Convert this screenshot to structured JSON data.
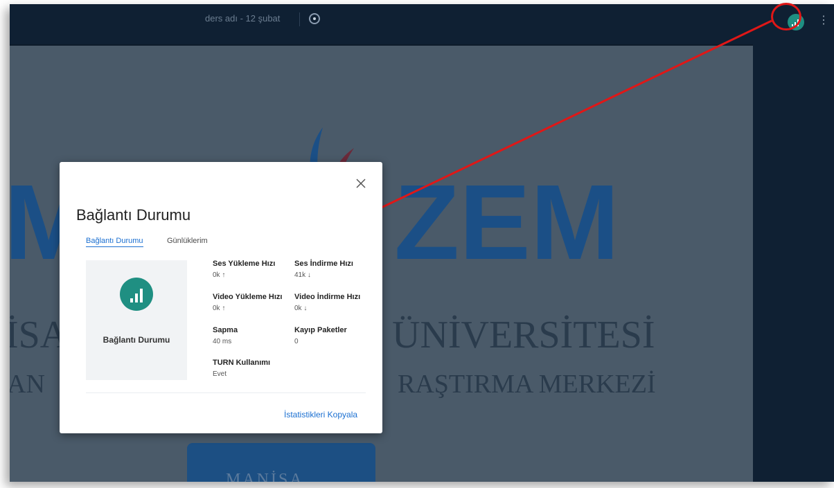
{
  "topbar": {
    "meeting_title": "ders adı - 12 şubat",
    "record_icon": "record-icon",
    "signal_icon": "signal-bars-icon",
    "more_icon": "more-vertical-icon"
  },
  "slide": {
    "watermark_left": "M",
    "watermark_right": "ZEM",
    "university_left": "İSA",
    "university_right": "ÜNİVERSİTESİ",
    "center_left": "AN",
    "center_right": "RAŞTIRMA MERKEZİ",
    "logo_text": "MANİSA"
  },
  "modal": {
    "title": "Bağlantı Durumu",
    "close_icon": "close-icon",
    "tabs": [
      {
        "label": "Bağlantı Durumu",
        "active": true
      },
      {
        "label": "Günlüklerim",
        "active": false
      }
    ],
    "status_label": "Bağlantı Durumu",
    "stats": [
      {
        "label": "Ses Yükleme Hızı",
        "value": "0k ↑"
      },
      {
        "label": "Ses İndirme Hızı",
        "value": "41k ↓"
      },
      {
        "label": "Video Yükleme Hızı",
        "value": "0k ↑"
      },
      {
        "label": "Video İndirme Hızı",
        "value": "0k ↓"
      },
      {
        "label": "Sapma",
        "value": "40 ms"
      },
      {
        "label": "Kayıp Paketler",
        "value": "0"
      },
      {
        "label": "TURN Kullanımı",
        "value": "Evet"
      }
    ],
    "copy_label": "İstatistikleri Kopyala"
  },
  "colors": {
    "topbar": "#0f2033",
    "accent_teal": "#1f8f82",
    "link_blue": "#1a6fd1",
    "annotation_red": "#e01717"
  }
}
